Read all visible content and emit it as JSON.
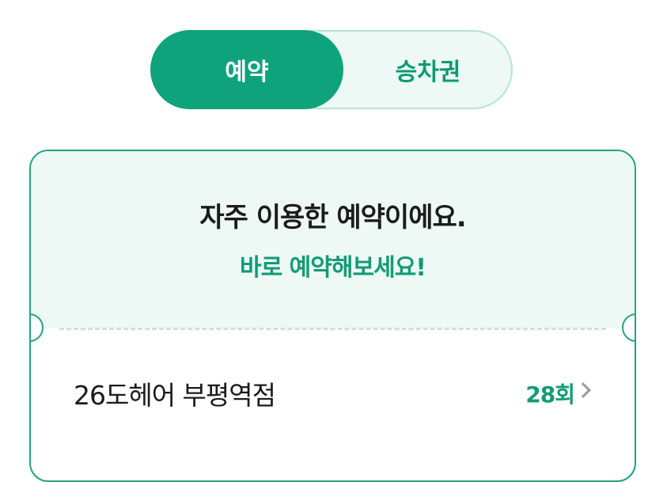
{
  "tabs": {
    "reserve": "예약",
    "ticket": "승차권"
  },
  "card": {
    "headline": "자주 이용한 예약이에요.",
    "subline": "바로 예약해보세요!",
    "items": [
      {
        "name": "26도헤어 부평역점",
        "count": "28회"
      }
    ]
  },
  "colors": {
    "accent": "#0ea37b",
    "accent_text": "#109c77",
    "card_bg": "#eef8f5",
    "border": "#21a482"
  },
  "icons": {
    "row_chevron": "chevron-right-icon"
  }
}
